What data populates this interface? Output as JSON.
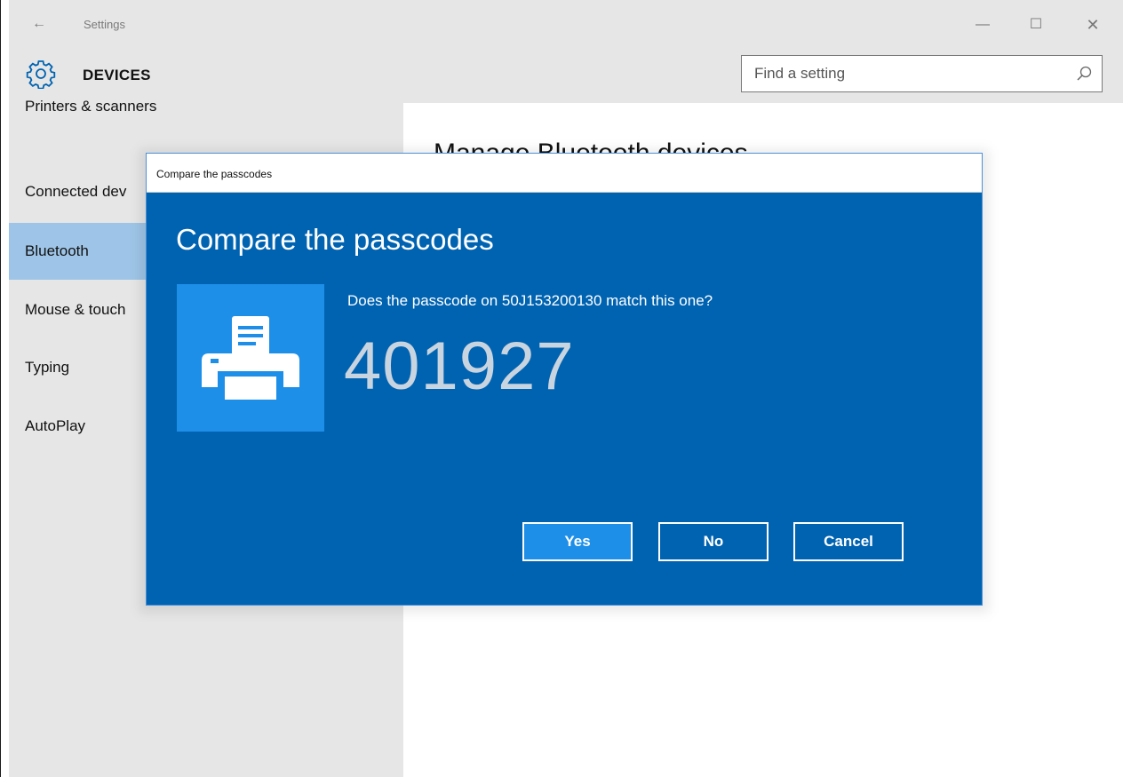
{
  "window": {
    "app_title": "Settings",
    "minimize_glyph": "—",
    "maximize_glyph": "☐",
    "close_glyph": "✕",
    "back_glyph": "←"
  },
  "header": {
    "section_title": "DEVICES",
    "search_placeholder": "Find a setting"
  },
  "sidebar": {
    "items": [
      {
        "label": "Printers & scanners",
        "selected": false
      },
      {
        "label": "Connected dev",
        "selected": false
      },
      {
        "label": "Bluetooth",
        "selected": true
      },
      {
        "label": "Mouse & touch",
        "selected": false
      },
      {
        "label": "Typing",
        "selected": false
      },
      {
        "label": "AutoPlay",
        "selected": false
      }
    ]
  },
  "content": {
    "title": "Manage Bluetooth devices"
  },
  "dialog": {
    "window_title": "Compare the passcodes",
    "heading": "Compare the passcodes",
    "question": "Does the passcode on 50J153200130 match this one?",
    "passcode": "401927",
    "buttons": {
      "yes": "Yes",
      "no": "No",
      "cancel": "Cancel"
    },
    "device_icon": "printer-icon"
  },
  "colors": {
    "dialog_bg": "#0063b1",
    "tile_bg": "#1e8fe8",
    "selected_nav": "#9ec5e7",
    "chrome_bg": "#e6e6e6"
  }
}
